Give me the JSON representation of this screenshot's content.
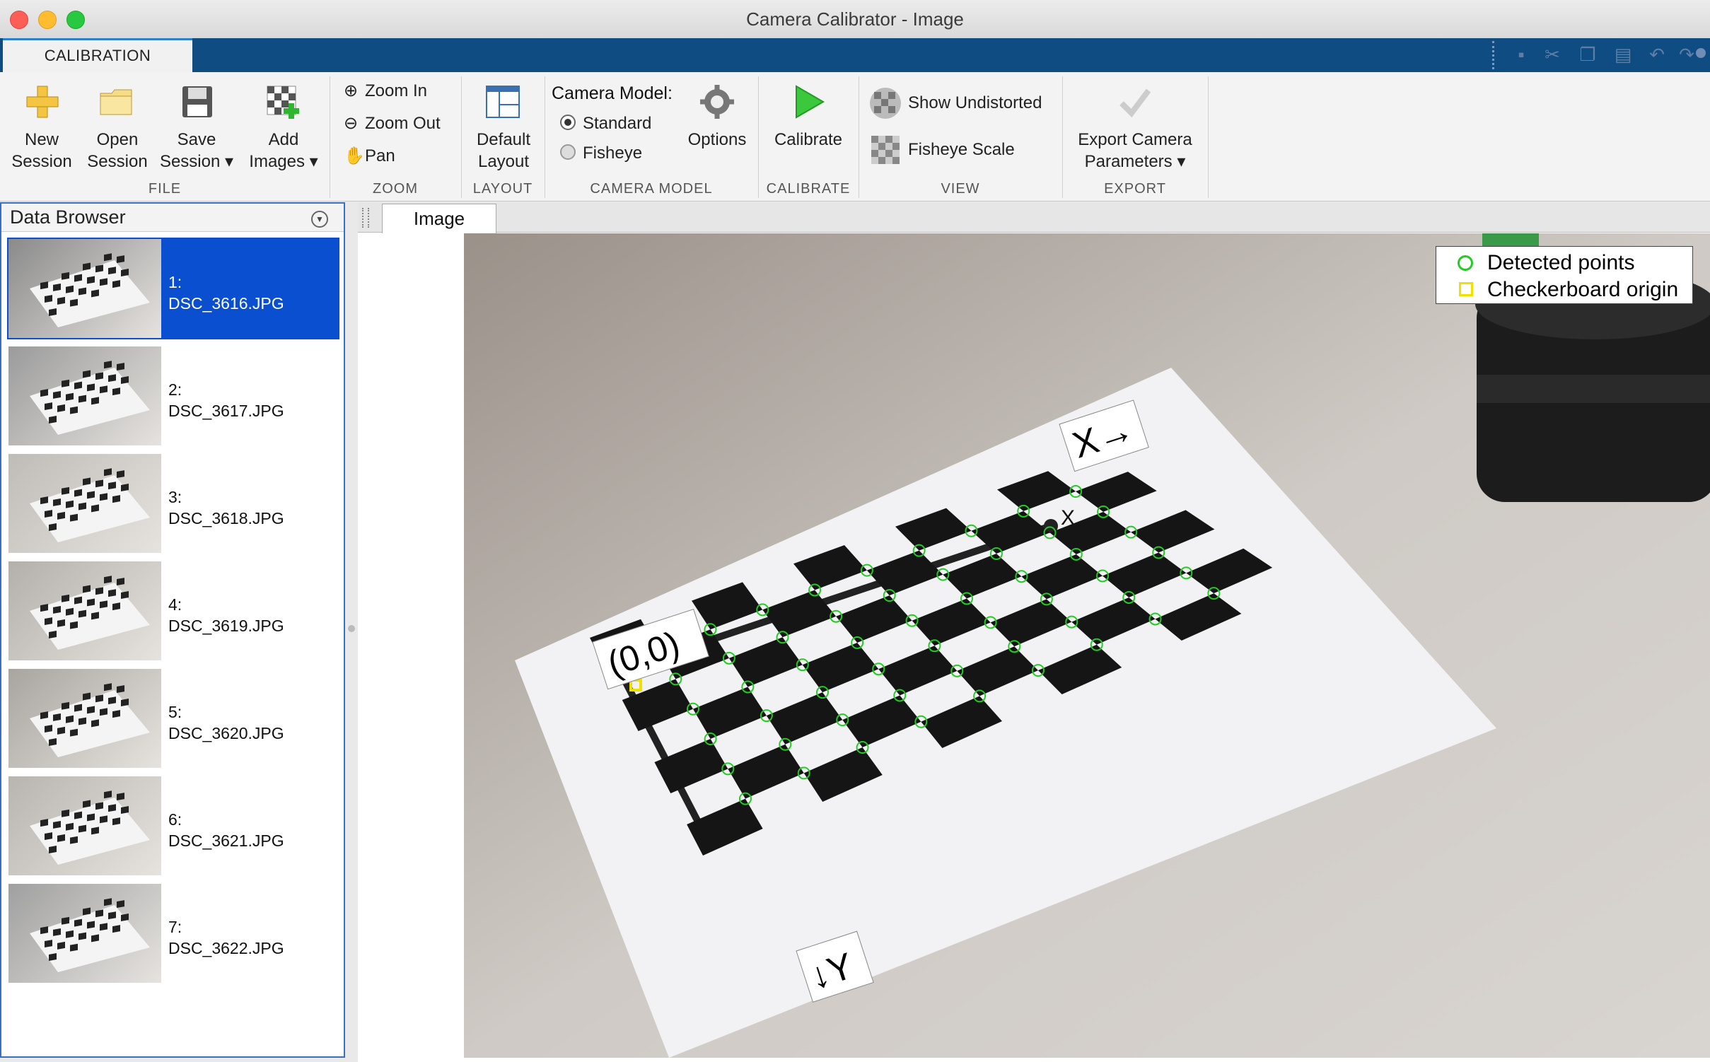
{
  "window": {
    "title": "Camera Calibrator - Image"
  },
  "tabs": {
    "calibration": "CALIBRATION"
  },
  "file": {
    "section": "FILE",
    "new_session": [
      "New",
      "Session"
    ],
    "open_session": [
      "Open",
      "Session"
    ],
    "save_session": [
      "Save",
      "Session ▾"
    ],
    "add_images": [
      "Add",
      "Images ▾"
    ]
  },
  "zoom": {
    "section": "ZOOM",
    "zoom_in": "Zoom In",
    "zoom_out": "Zoom Out",
    "pan": "Pan"
  },
  "layout": {
    "section": "LAYOUT",
    "default_layout": [
      "Default",
      "Layout"
    ]
  },
  "camera_model": {
    "section": "CAMERA MODEL",
    "label": "Camera Model:",
    "options": [
      "Standard",
      "Fisheye"
    ],
    "selected": "Standard",
    "options_button": "Options"
  },
  "calibrate": {
    "section": "CALIBRATE",
    "button": "Calibrate"
  },
  "view": {
    "section": "VIEW",
    "show_undistorted": "Show Undistorted",
    "fisheye_scale": "Fisheye Scale"
  },
  "export": {
    "section": "EXPORT",
    "button": [
      "Export Camera",
      "Parameters ▾"
    ]
  },
  "data_browser": {
    "title": "Data Browser",
    "items": [
      {
        "index": "1:",
        "name": "DSC_3616.JPG",
        "selected": true
      },
      {
        "index": "2:",
        "name": "DSC_3617.JPG",
        "selected": false
      },
      {
        "index": "3:",
        "name": "DSC_3618.JPG",
        "selected": false
      },
      {
        "index": "4:",
        "name": "DSC_3619.JPG",
        "selected": false
      },
      {
        "index": "5:",
        "name": "DSC_3620.JPG",
        "selected": false
      },
      {
        "index": "6:",
        "name": "DSC_3621.JPG",
        "selected": false
      },
      {
        "index": "7:",
        "name": "DSC_3622.JPG",
        "selected": false
      }
    ]
  },
  "image_panel": {
    "tab": "Image",
    "legend": {
      "detected": "Detected points",
      "origin": "Checkerboard origin"
    },
    "annotations": {
      "origin": "(0,0)",
      "x_axis": "X→",
      "y_axis": "↓Y",
      "x_small": "X",
      "y_small": "Y"
    }
  },
  "colors": {
    "accent": "#0f4c81",
    "selection": "#0b4fd1",
    "detected": "#22cc22",
    "origin": "#f0e000"
  }
}
